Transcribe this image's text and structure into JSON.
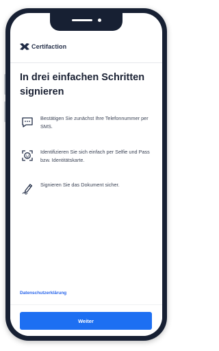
{
  "header": {
    "brand": "Certifaction"
  },
  "main": {
    "title": "In drei einfachen Schritten signieren",
    "steps": [
      {
        "icon": "sms-chat-icon",
        "text": "Bestätigen Sie zunächst Ihre Telefonnummer per SMS."
      },
      {
        "icon": "face-id-icon",
        "text": "Identifizieren Sie sich einfach per Selfie und Pass bzw. Identitätskarte."
      },
      {
        "icon": "signature-pen-icon",
        "text": "Signieren Sie das Dokument sicher."
      }
    ]
  },
  "footer": {
    "privacy_link": "Datenschutzerklärung",
    "next_button": "Weiter"
  },
  "colors": {
    "accent": "#1d6ff2",
    "link": "#2563eb",
    "frame": "#172033",
    "text": "#1a2133"
  }
}
